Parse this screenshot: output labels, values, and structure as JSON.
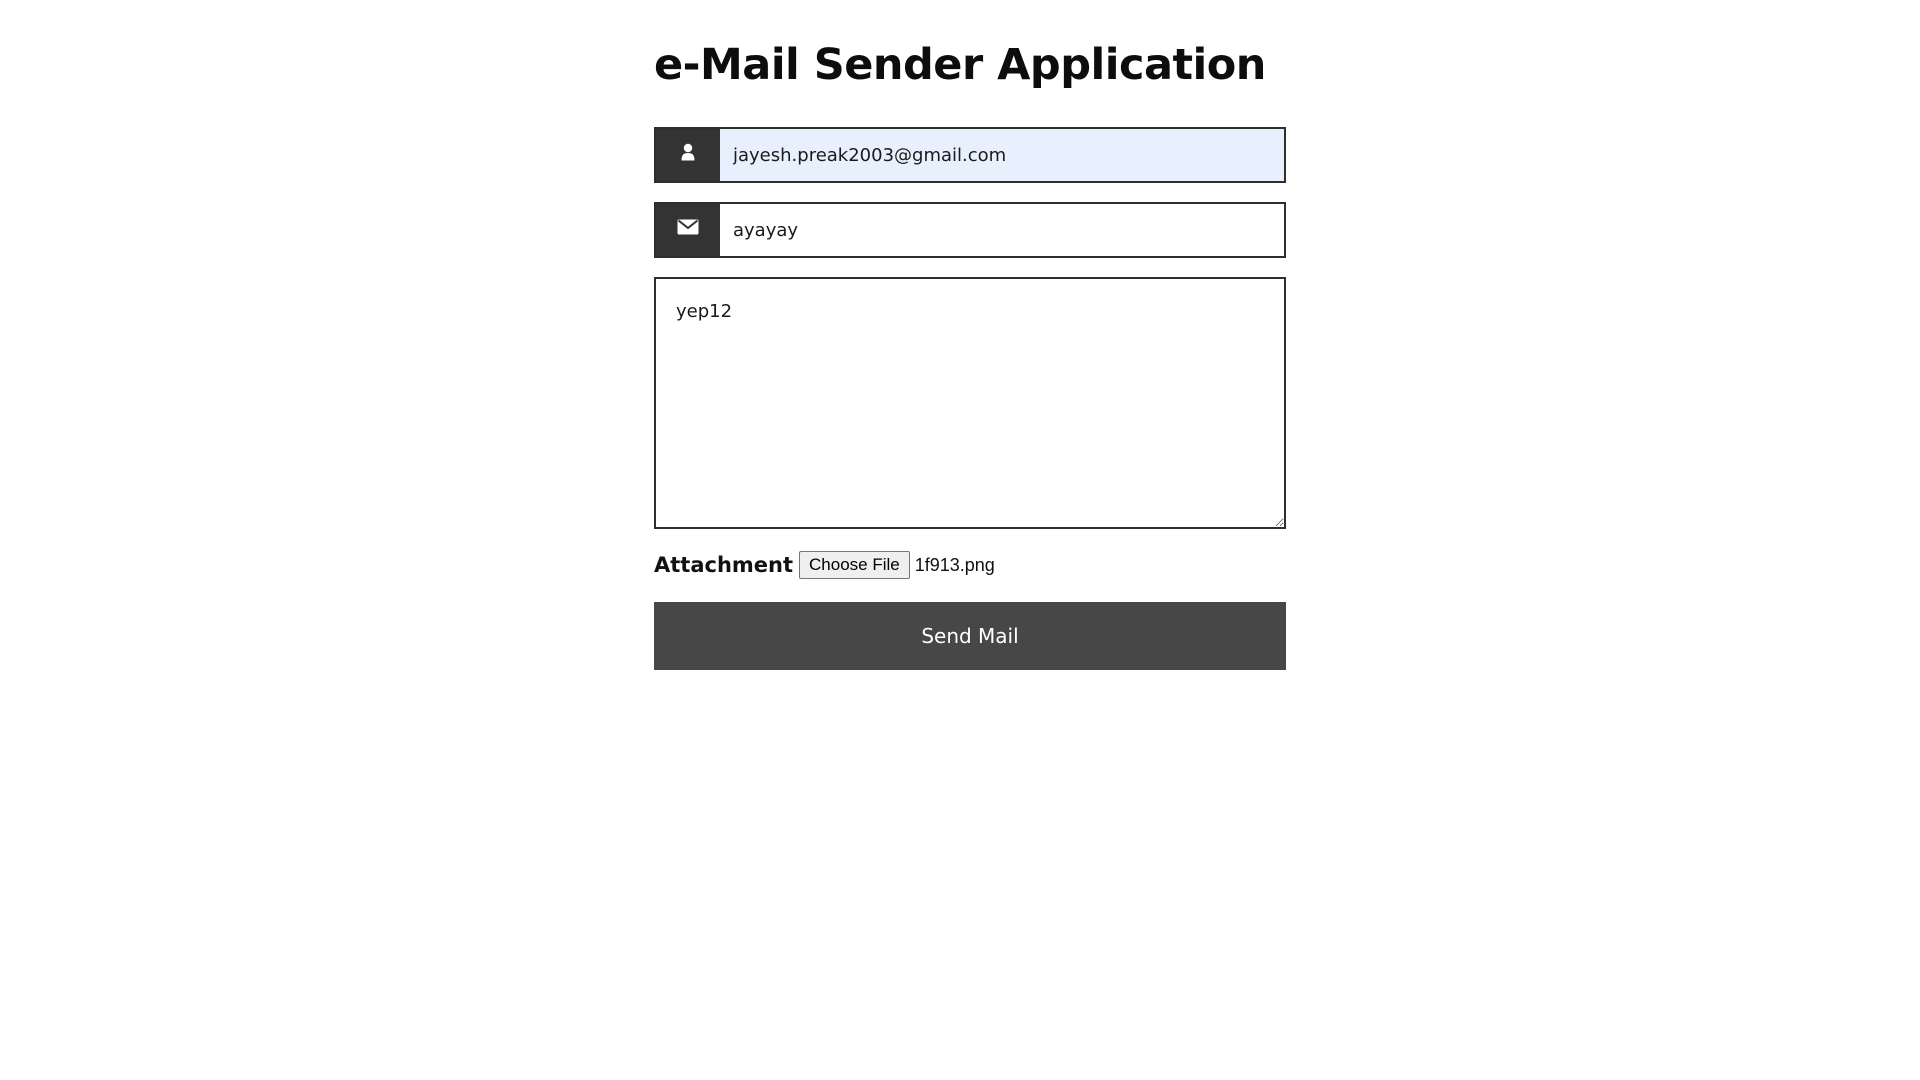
{
  "page": {
    "title": "e-Mail Sender Application"
  },
  "form": {
    "email": {
      "value": "jayesh.preak2003@gmail.com",
      "icon": "user-icon"
    },
    "subject": {
      "value": "ayayay",
      "icon": "envelope-icon"
    },
    "message": {
      "value": "yep12"
    },
    "attachment": {
      "label": "Attachment",
      "button_label": "Choose File",
      "file_name": "1f913.png"
    },
    "send_label": "Send Mail"
  },
  "colors": {
    "icon_bg": "#333333",
    "autofill_bg": "#e8f0fe",
    "button_bg": "#474747",
    "border": "#2e2e2e"
  }
}
